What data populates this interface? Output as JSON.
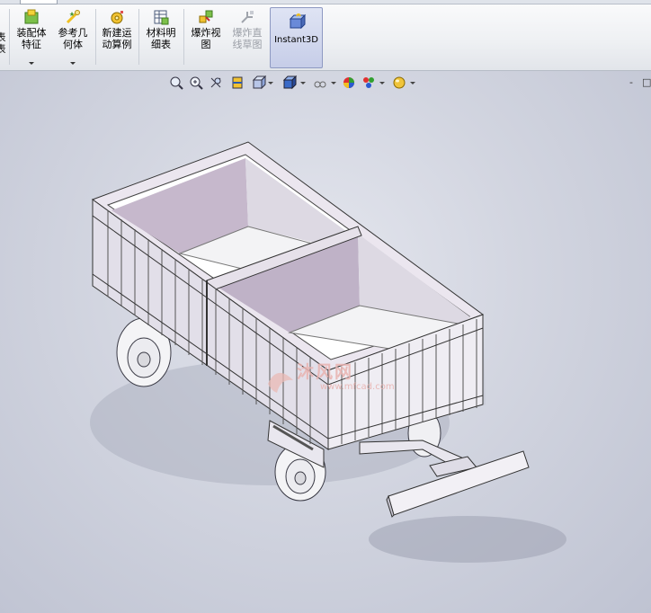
{
  "ribbon": {
    "partial_label": "表\n表",
    "assembly_feature": "装配体\n特征",
    "reference_geometry": "参考几\n何体",
    "new_motion_study": "新建运\n动算例",
    "bom": "材料明\n细表",
    "exploded_view": "爆炸视\n图",
    "explode_line_sketch": "爆炸直\n线草图",
    "instant3d": "Instant3D"
  },
  "view_toolbar": {
    "icons": [
      "zoom-to-fit-icon",
      "zoom-to-area-icon",
      "previous-view-icon",
      "section-view-icon",
      "view-orientation-icon",
      "display-style-icon",
      "hide-show-items-icon",
      "edit-appearance-icon",
      "apply-scene-icon",
      "view-settings-icon"
    ]
  },
  "window_controls": {
    "minimize": "-",
    "restore": "□"
  },
  "watermark": {
    "brand": "沐风网",
    "url": "www.mfcad.com"
  },
  "colors": {
    "viewport_bg": "#cdd0dc",
    "accent": "#c6cde8"
  }
}
